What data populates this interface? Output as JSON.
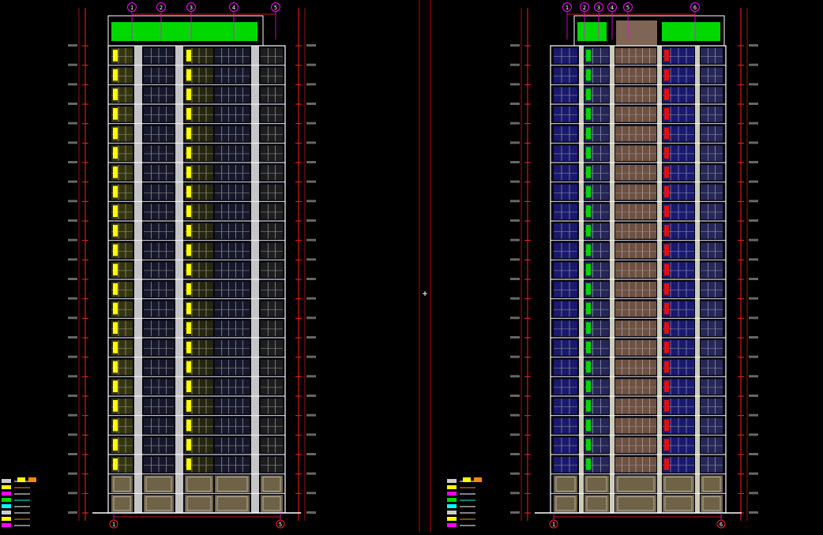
{
  "drawing": {
    "background": "#000000",
    "colors": {
      "frame": "#c00000",
      "grid_line": "#ff2020",
      "axis_magenta": "#ff00ff",
      "floor_line": "#ffffff",
      "roof_green": "#00d800",
      "yellow_panel": "#ffff00",
      "glass_blue": "#2020c8",
      "podium_tan": "#8a7a55",
      "core_peach": "#e8b89a",
      "legend_text": "#00ffff"
    },
    "sheets": [
      {
        "id": "elevation-a",
        "floors": 24,
        "podium_floors": 2,
        "bays": 6,
        "axis_labels": [
          "1",
          "2",
          "3",
          "4",
          "5"
        ],
        "bottom_axis_labels": [
          "1",
          "5"
        ]
      },
      {
        "id": "elevation-b",
        "floors": 24,
        "podium_floors": 2,
        "bays": 6,
        "axis_labels": [
          "1",
          "2",
          "3",
          "4",
          "5",
          "6"
        ],
        "bottom_axis_labels": [
          "1",
          "6"
        ]
      }
    ],
    "legend_icons": [
      "hatch-swatch",
      "yellow-swatch",
      "magenta-swatch",
      "green-swatch",
      "cyan-swatch"
    ]
  }
}
